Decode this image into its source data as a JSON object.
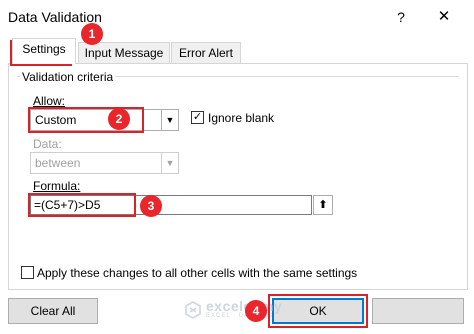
{
  "window": {
    "title": "Data Validation",
    "help_glyph": "?",
    "close_glyph": "✕"
  },
  "tabs": [
    {
      "label": "Settings",
      "active": true
    },
    {
      "label": "Input Message",
      "active": false
    },
    {
      "label": "Error Alert",
      "active": false
    }
  ],
  "settings": {
    "group_label": "Validation criteria",
    "allow_label": "Allow:",
    "allow_value": "Custom",
    "ignore_blank_label": "Ignore blank",
    "ignore_blank_checked": true,
    "data_label": "Data:",
    "data_value": "between",
    "formula_label": "Formula:",
    "formula_value": "=(C5+7)>D5",
    "apply_all_label": "Apply these changes to all other cells with the same settings",
    "apply_all_checked": false
  },
  "buttons": {
    "clear_all": "Clear All",
    "ok": "OK"
  },
  "annotations": [
    "1",
    "2",
    "3",
    "4"
  ],
  "watermark": {
    "name": "exceldemy",
    "tagline": "EXCEL · DATA · BI"
  },
  "colors": {
    "highlight": "#d9232a",
    "badge": "#e8262b",
    "focus": "#0078d7"
  }
}
